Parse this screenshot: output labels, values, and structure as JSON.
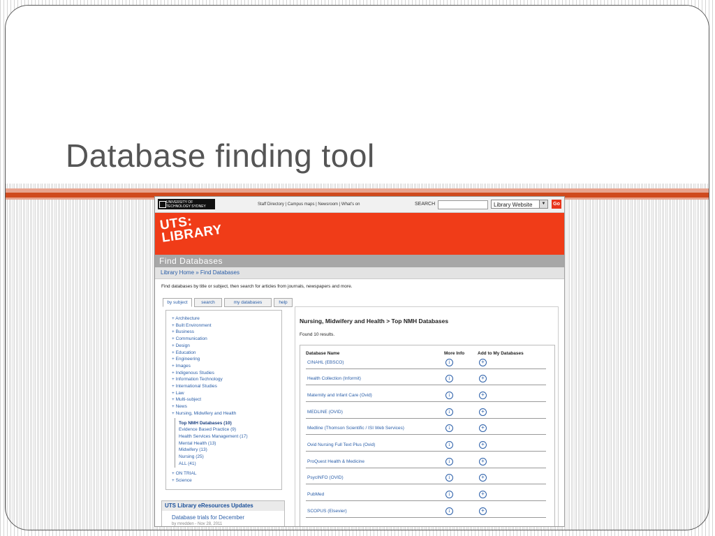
{
  "slide": {
    "title": "Database finding tool",
    "colors": {
      "rule_dark": "#cf4a1e",
      "rule_light": "#e7a48f",
      "title_text": "#555555"
    }
  },
  "website": {
    "header": {
      "logo_line1": "UNIVERSITY OF",
      "logo_line2": "TECHNOLOGY SYDNEY",
      "links": "Staff Directory | Campus maps | Newsroom | What's on",
      "search_label": "SEARCH",
      "search_value": "",
      "scope_selected": "Library Website",
      "go_label": "Go"
    },
    "banner": {
      "logo_line1": "UTS:",
      "logo_line2": "LIBRARY",
      "color": "#f03c18"
    },
    "page_title": "Find Databases",
    "breadcrumb": "Library Home » Find Databases",
    "intro": "Find databases by title or subject, then search for articles from journals, newspapers and more.",
    "tabs": [
      {
        "label": "by subject",
        "active": true
      },
      {
        "label": "search",
        "active": false
      },
      {
        "label": "my databases",
        "active": false
      },
      {
        "label": "help",
        "active": false
      }
    ],
    "subjects": [
      "+ Architecture",
      "+ Built Environment",
      "+ Business",
      "+ Communication",
      "+ Design",
      "+ Education",
      "+ Engineering",
      "+ Images",
      "+ Indigenous Studies",
      "+ Information Technology",
      "+ International Studies",
      "+ Law",
      "+ Multi-subject",
      "+ News",
      "+ Nursing, Midwifery and Health"
    ],
    "nursing_subcategories": [
      "Top NMH Databases (10)",
      "Evidence Based Practice (9)",
      "Health Services Management (17)",
      "Mental Health (13)",
      "Midwifery (13)",
      "Nursing (25)",
      "ALL (41)"
    ],
    "subjects_after": [
      "+ ON TRIAL",
      "+ Science"
    ],
    "updates": {
      "title": "UTS Library eResources Updates",
      "item": "Database trials for December",
      "meta": "by mredden - Nov 28, 2011"
    },
    "results": {
      "heading": "Nursing, Midwifery and Health > Top NMH Databases",
      "found": "Found 10 results.",
      "columns": [
        "Database Name",
        "More Info",
        "Add to My Databases"
      ],
      "info_icon": "info-icon",
      "add_icon": "plus-circle-icon",
      "rows": [
        "CINAHL (EBSCO)",
        "Health Collection (Informit)",
        "Maternity and Infant Care (Ovid)",
        "MEDLINE (OVID)",
        "Medline (Thomson Scientific / ISI Web Services)",
        "Ovid Nursing Full Text Plus (Ovid)",
        "ProQuest Health & Medicine",
        "PsycINFO (OVID)",
        "PubMed",
        "SCOPUS (Elsevier)"
      ]
    }
  }
}
